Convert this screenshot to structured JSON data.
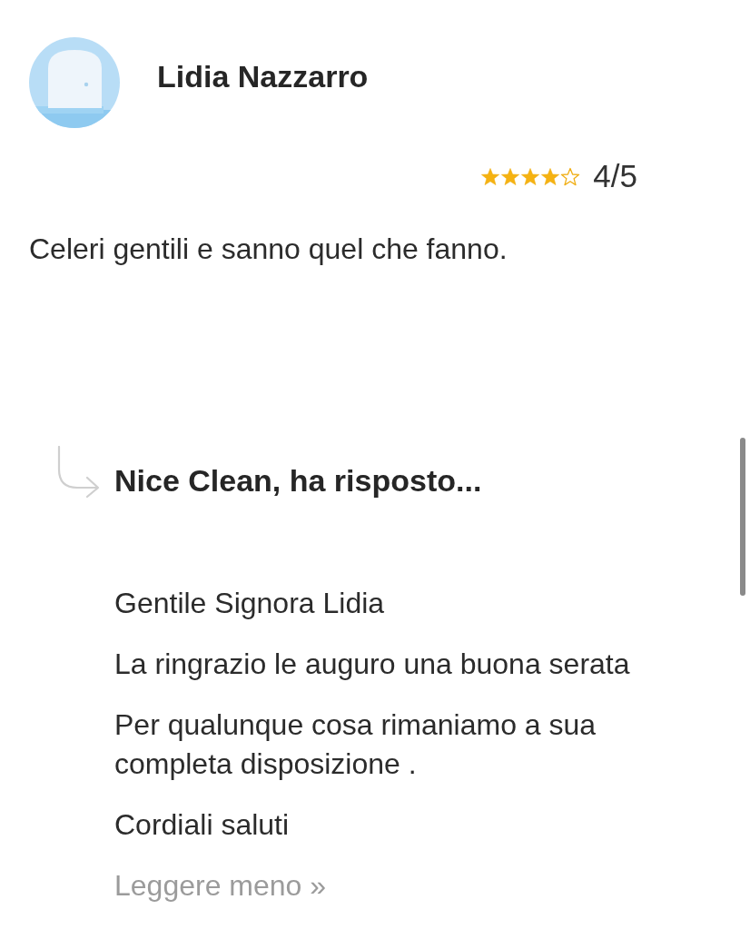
{
  "review": {
    "author": "Lidia Nazzarro",
    "stars": 4,
    "rating": "4/5",
    "text": "Celeri gentili e sanno quel che fanno."
  },
  "reply": {
    "heading": "Nice Clean, ha risposto...",
    "paragraphs": [
      "Gentile Signora Lidia",
      "La ringrazio le auguro una buona serata",
      "Per qualunque cosa rimaniamo a sua completa disposizione .",
      "Cordiali saluti"
    ],
    "toggle_link": "Leggere meno »"
  }
}
